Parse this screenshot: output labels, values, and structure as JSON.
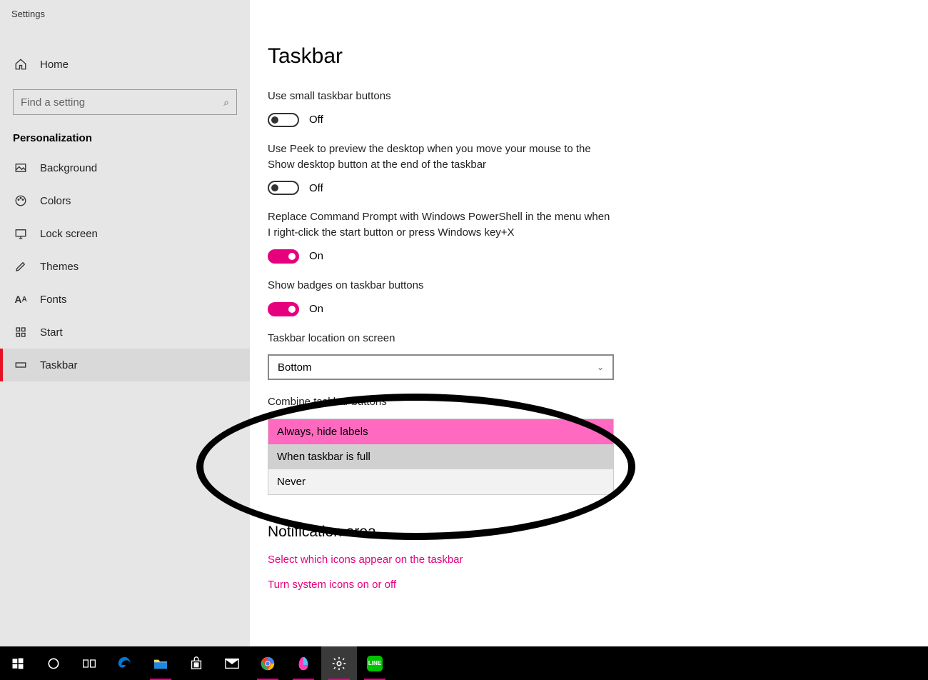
{
  "app_title": "Settings",
  "sidebar": {
    "home": "Home",
    "search_placeholder": "Find a setting",
    "category": "Personalization",
    "items": [
      {
        "label": "Background"
      },
      {
        "label": "Colors"
      },
      {
        "label": "Lock screen"
      },
      {
        "label": "Themes"
      },
      {
        "label": "Fonts"
      },
      {
        "label": "Start"
      },
      {
        "label": "Taskbar"
      }
    ]
  },
  "main": {
    "title": "Taskbar",
    "settings": {
      "small_buttons": {
        "label": "Use small taskbar buttons",
        "state": "Off"
      },
      "peek": {
        "label": "Use Peek to preview the desktop when you move your mouse to the Show desktop button at the end of the taskbar",
        "state": "Off"
      },
      "powershell": {
        "label": "Replace Command Prompt with Windows PowerShell in the menu when I right-click the start button or press Windows key+X",
        "state": "On"
      },
      "badges": {
        "label": "Show badges on taskbar buttons",
        "state": "On"
      },
      "location": {
        "label": "Taskbar location on screen",
        "value": "Bottom"
      },
      "combine": {
        "label": "Combine taskbar buttons",
        "options": [
          "Always, hide labels",
          "When taskbar is full",
          "Never"
        ]
      }
    },
    "notification": {
      "title": "Notification area",
      "link1": "Select which icons appear on the taskbar",
      "link2": "Turn system icons on or off"
    }
  },
  "accent": "#e6007e"
}
